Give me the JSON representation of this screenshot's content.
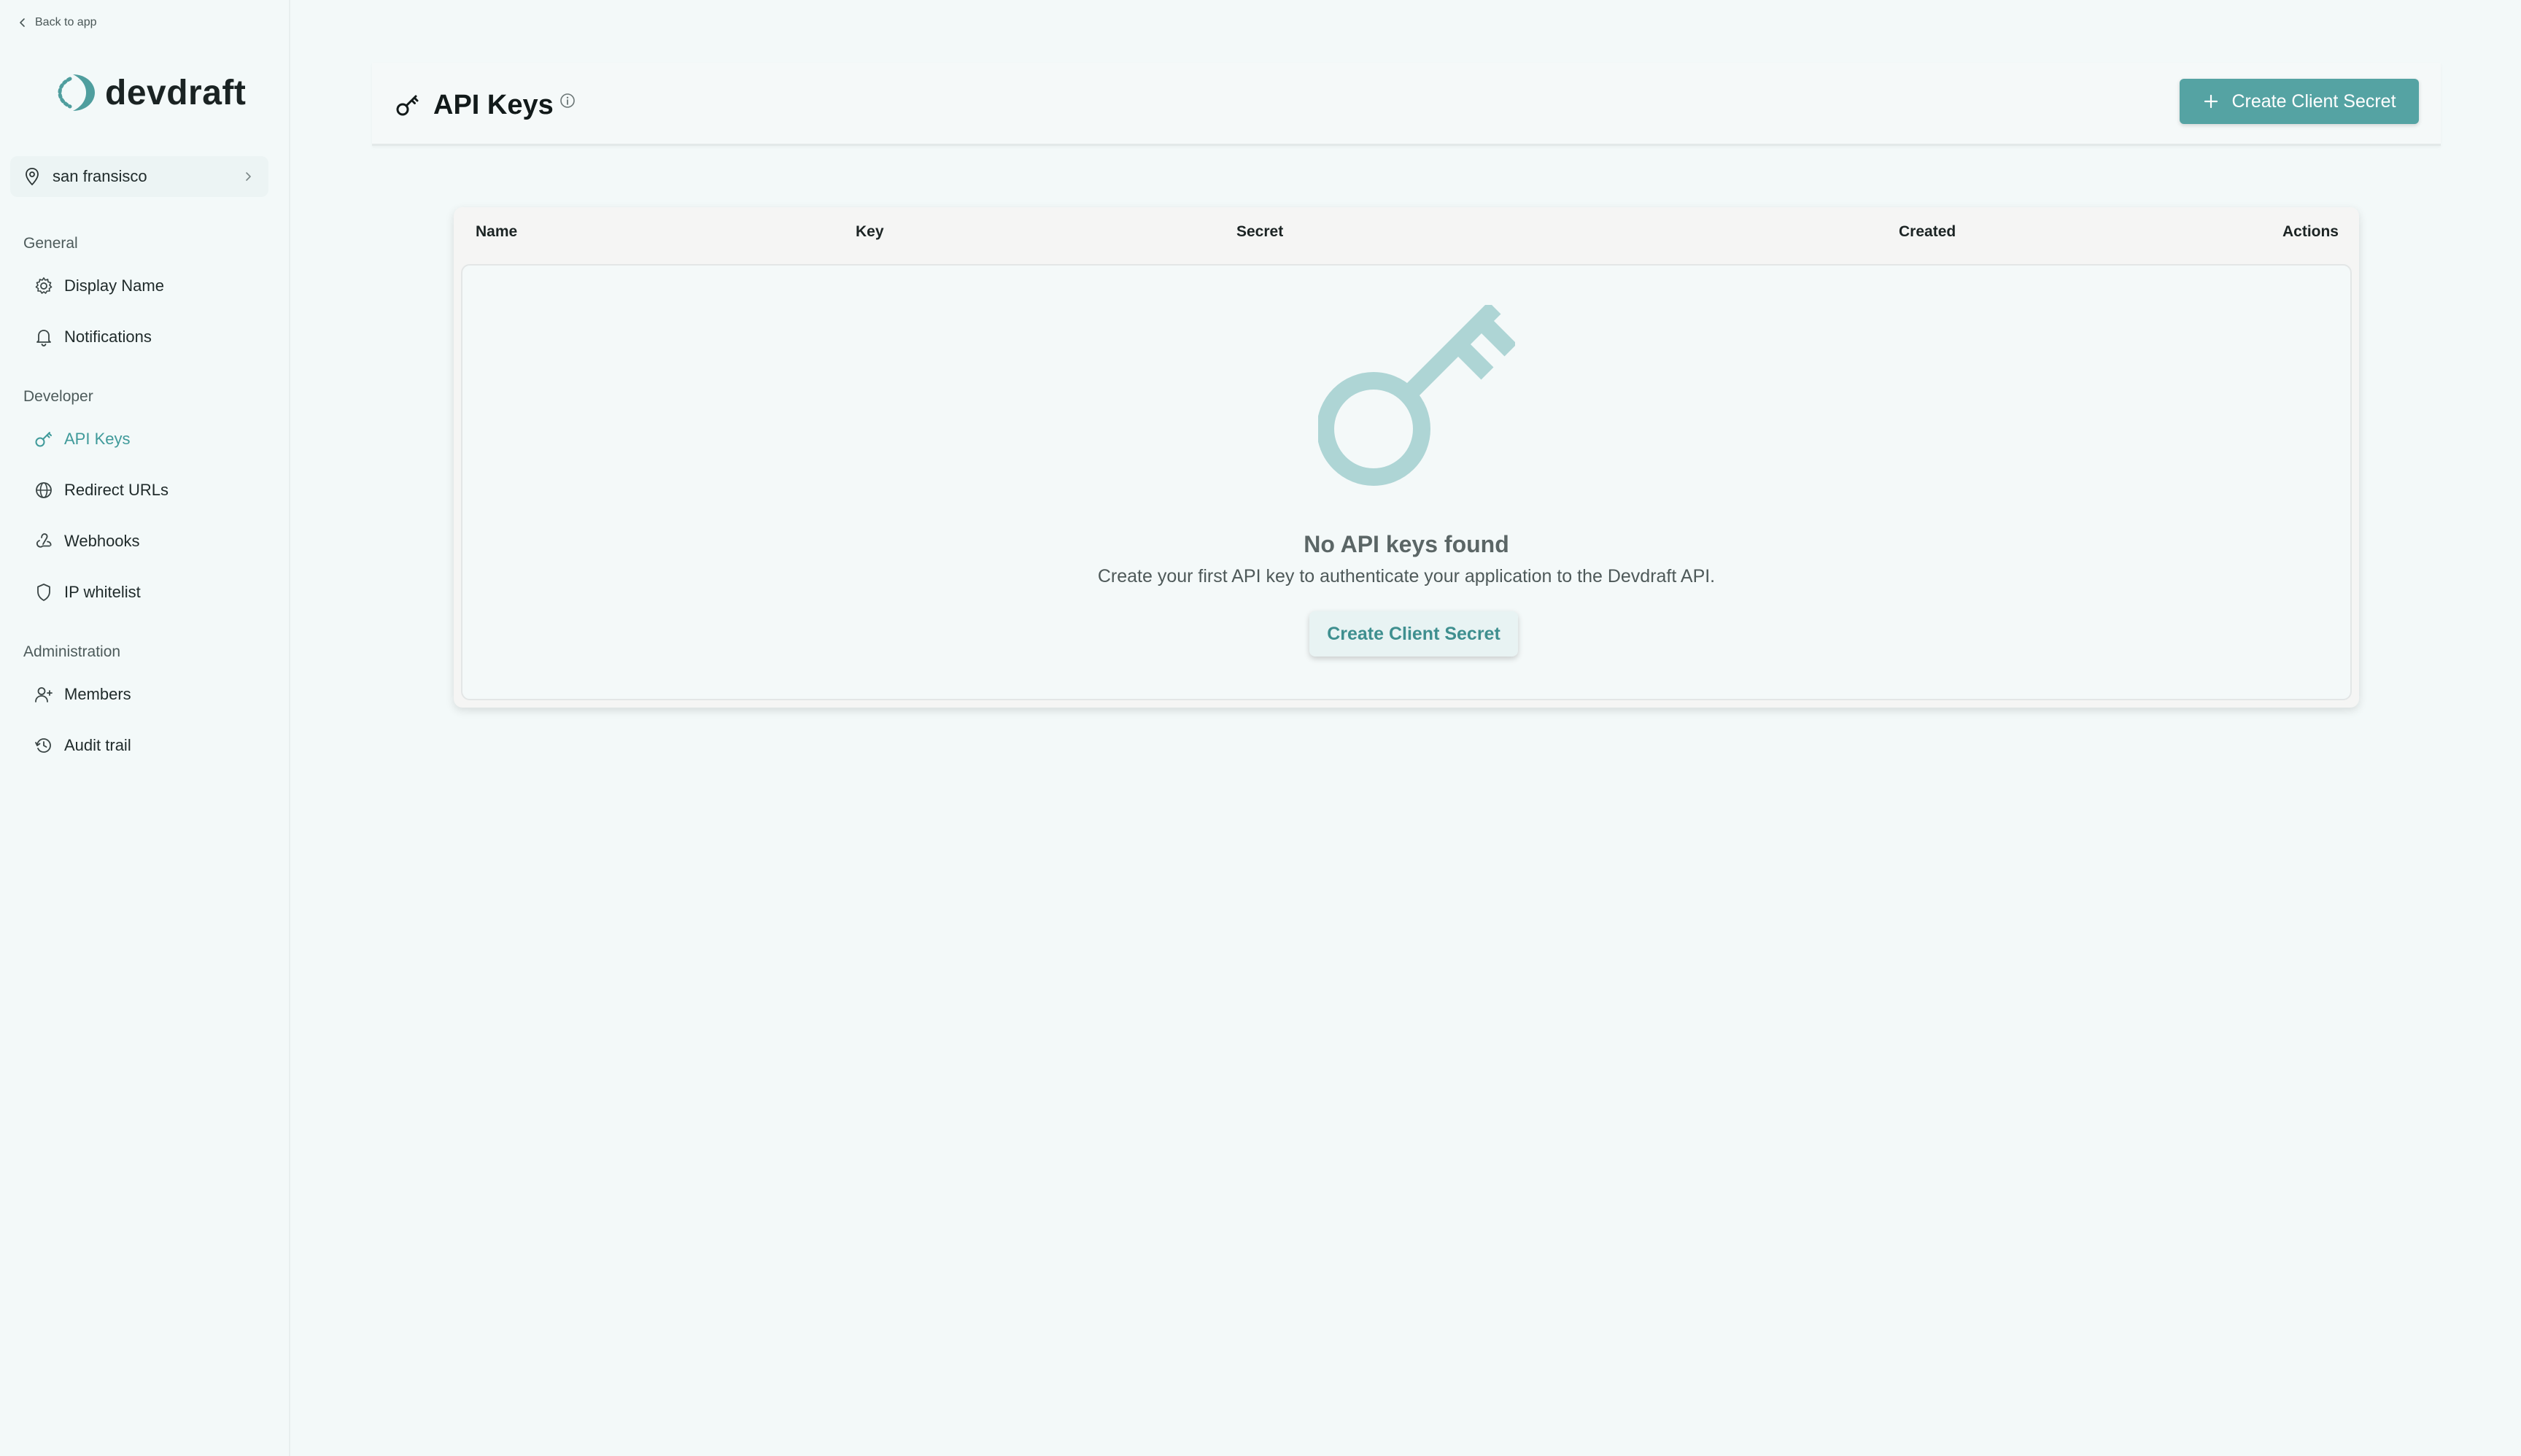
{
  "sidebar": {
    "back_label": "Back to app",
    "brand": "devdraft",
    "location": "san fransisco",
    "sections": {
      "general": "General",
      "developer": "Developer",
      "administration": "Administration"
    },
    "items": {
      "display_name": "Display Name",
      "notifications": "Notifications",
      "api_keys": "API Keys",
      "redirect_urls": "Redirect URLs",
      "webhooks": "Webhooks",
      "ip_whitelist": "IP whitelist",
      "members": "Members",
      "audit_trail": "Audit trail"
    },
    "active_item": "api_keys"
  },
  "header": {
    "title": "API Keys",
    "create_button": "Create Client Secret"
  },
  "table": {
    "columns": [
      "Name",
      "Key",
      "Secret",
      "Created",
      "Actions"
    ],
    "rows": [],
    "empty_title": "No API keys found",
    "empty_description": "Create your first API key to authenticate your application to the Devdraft API.",
    "empty_button": "Create Client Secret"
  },
  "colors": {
    "accent": "#55a3a3",
    "accent_light": "#aed5d5",
    "active_nav": "#3f9a9a",
    "background": "#f3f9f9"
  },
  "icons": {
    "back": "chevron-left-icon",
    "logo": "devdraft-logo-icon",
    "location": "map-pin-icon",
    "display_name": "gear-icon",
    "notifications": "bell-icon",
    "api_keys": "key-icon",
    "redirect_urls": "globe-icon",
    "webhooks": "webhook-icon",
    "ip_whitelist": "shield-icon",
    "members": "user-plus-icon",
    "audit_trail": "history-icon",
    "info": "info-icon",
    "create": "plus-icon"
  }
}
